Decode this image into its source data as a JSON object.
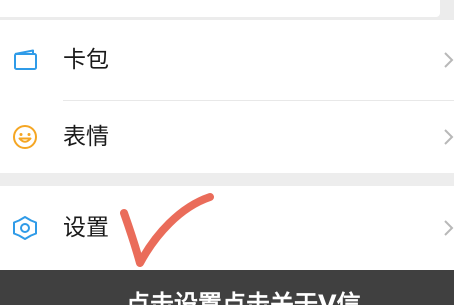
{
  "menu": {
    "items": [
      {
        "label": "卡包",
        "icon": "wallet-card-icon"
      },
      {
        "label": "表情",
        "icon": "emoji-smiley-icon"
      },
      {
        "label": "设置",
        "icon": "gear-icon"
      }
    ]
  },
  "caption": {
    "text": "点击设置点击关于V信"
  },
  "colors": {
    "icon_blue": "#2f9be8",
    "icon_yellow": "#f5a623",
    "checkmark_red": "#e8604c",
    "caption_bg": "#404040",
    "section_gap": "#ededed"
  }
}
